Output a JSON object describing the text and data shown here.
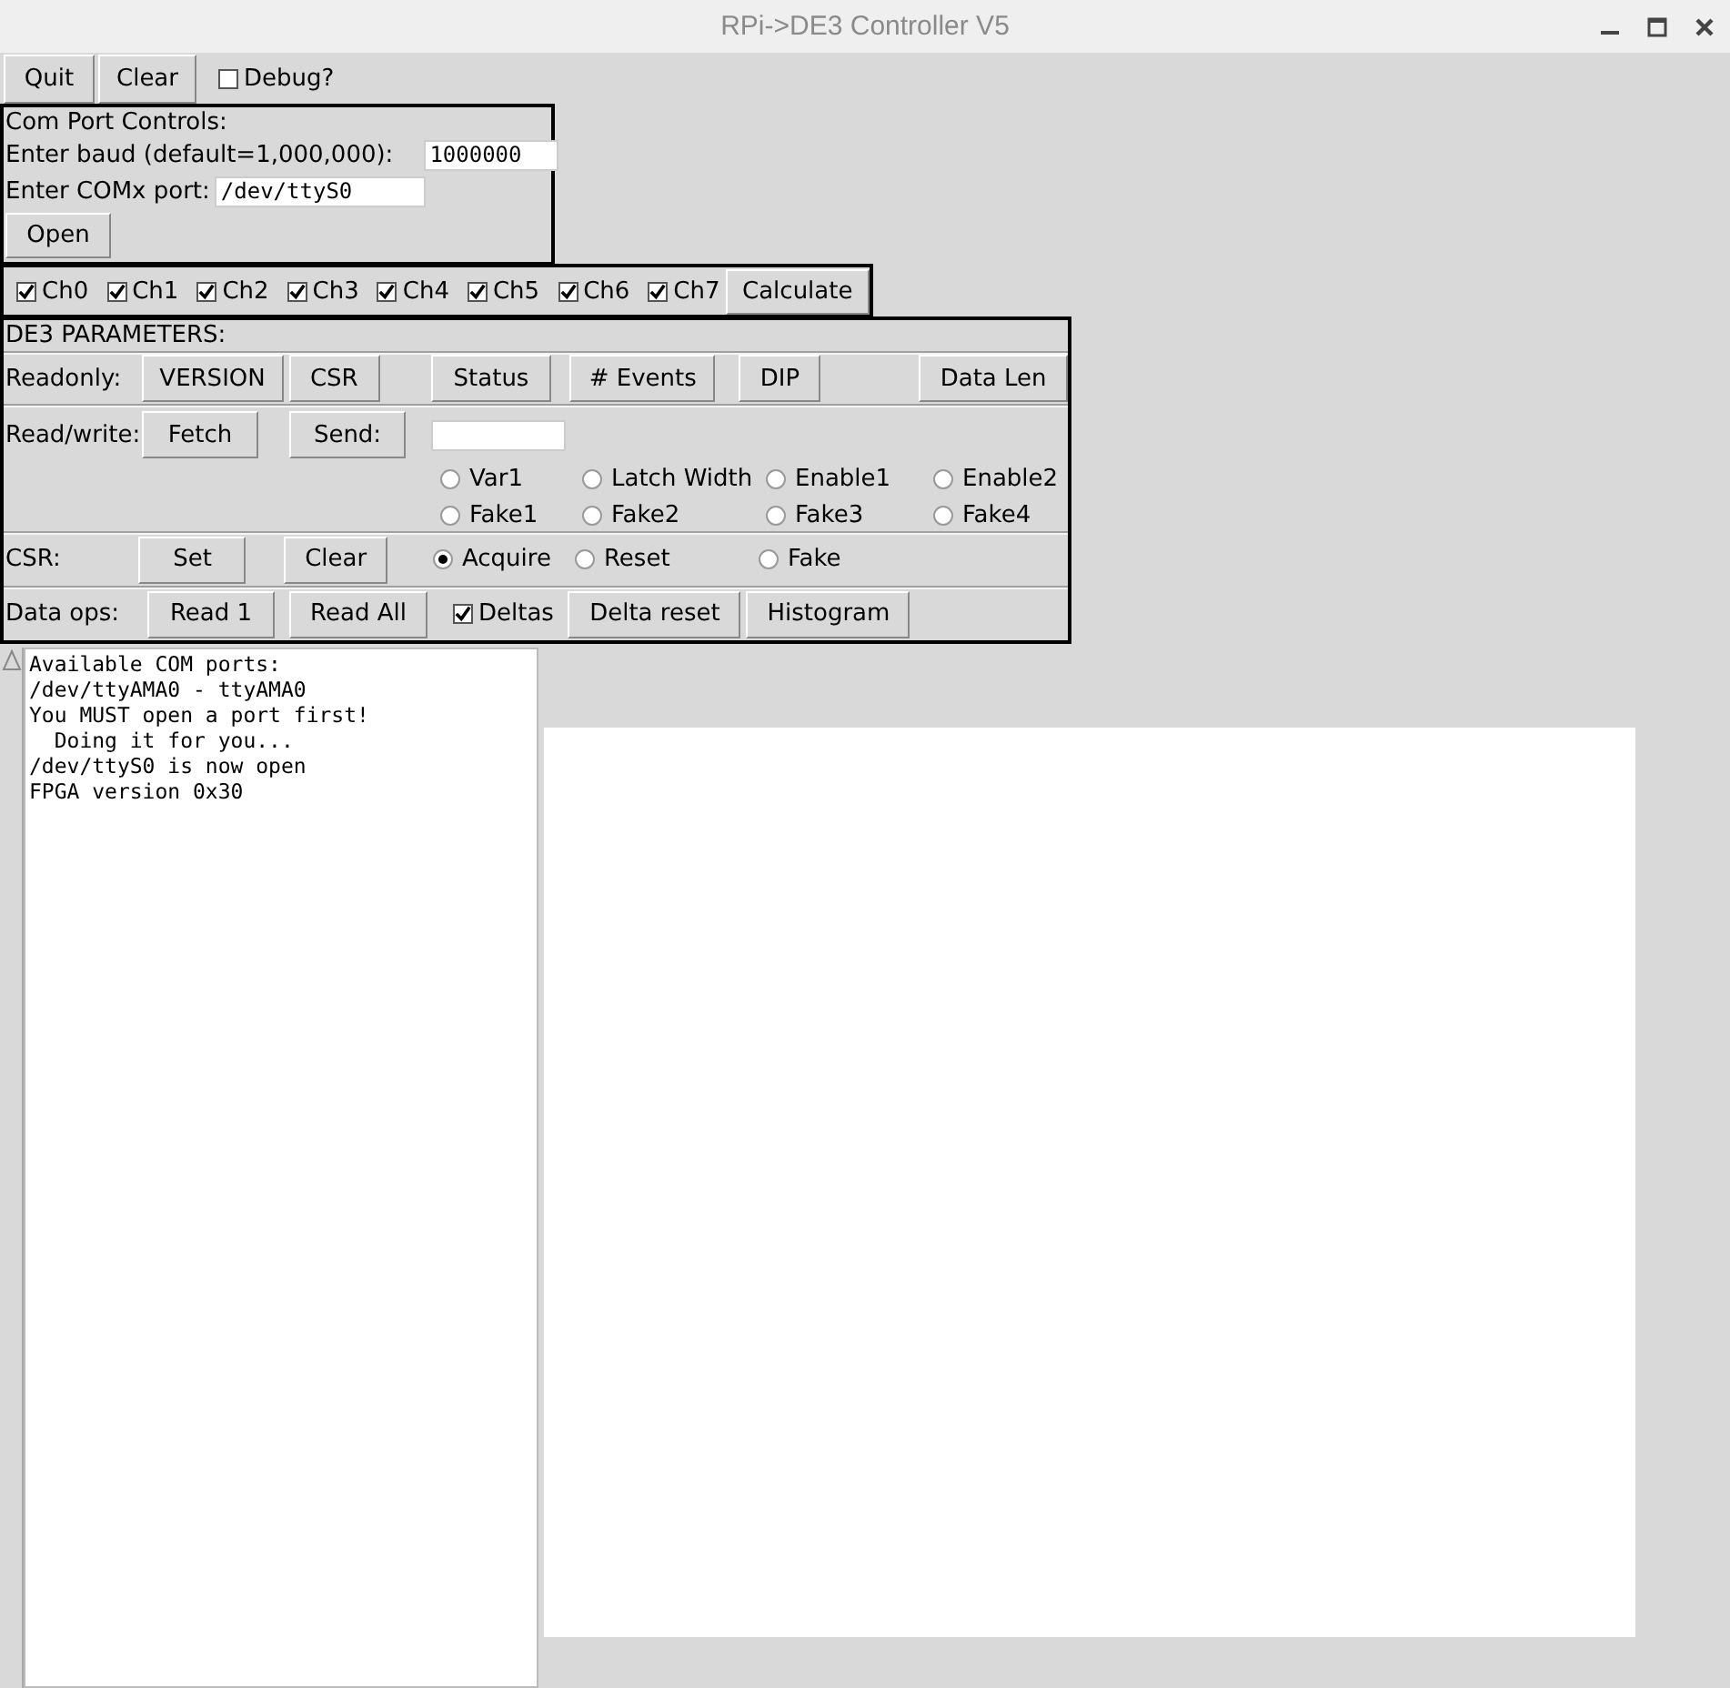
{
  "window": {
    "title": "RPi->DE3 Controller V5"
  },
  "toolbar": {
    "buttons": [
      "Quit",
      "Clear"
    ],
    "debug": {
      "label": "Debug?",
      "checked": false
    }
  },
  "com_port": {
    "title": "Com Port Controls:",
    "baud_label": "Enter baud (default=1,000,000):",
    "baud_value": "1000000",
    "port_label": "Enter COMx port:",
    "port_value": "/dev/ttyS0",
    "open_button": "Open"
  },
  "channels": {
    "items": [
      {
        "label": "Ch0",
        "checked": true
      },
      {
        "label": "Ch1",
        "checked": true
      },
      {
        "label": "Ch2",
        "checked": true
      },
      {
        "label": "Ch3",
        "checked": true
      },
      {
        "label": "Ch4",
        "checked": true
      },
      {
        "label": "Ch5",
        "checked": true
      },
      {
        "label": "Ch6",
        "checked": true
      },
      {
        "label": "Ch7",
        "checked": true
      }
    ],
    "button": "Calculate"
  },
  "de3": {
    "title": "DE3 PARAMETERS:",
    "readonly": {
      "label": "Readonly:",
      "buttons": [
        "VERSION",
        "CSR",
        "Status",
        "# Events",
        "DIP",
        "Data Len"
      ]
    },
    "readwrite": {
      "label": "Read/write:",
      "buttons": [
        "Fetch",
        "Send:"
      ],
      "options": [
        {
          "label": "Var1",
          "selected": false
        },
        {
          "label": "Latch Width",
          "selected": false
        },
        {
          "label": "Enable1",
          "selected": false
        },
        {
          "label": "Enable2",
          "selected": false
        },
        {
          "label": "Fake1",
          "selected": false
        },
        {
          "label": "Fake2",
          "selected": false
        },
        {
          "label": "Fake3",
          "selected": false
        },
        {
          "label": "Fake4",
          "selected": false
        }
      ]
    },
    "csr": {
      "label": "CSR:",
      "buttons": [
        "Set",
        "Clear"
      ],
      "options": [
        {
          "label": "Acquire",
          "selected": true
        },
        {
          "label": "Reset",
          "selected": false
        },
        {
          "label": "Fake",
          "selected": false
        }
      ]
    },
    "data_ops": {
      "label": "Data ops:",
      "items": [
        {
          "kind": "button",
          "label": "Read 1"
        },
        {
          "kind": "button",
          "label": "Read All"
        },
        {
          "kind": "checkbox",
          "label": "Deltas",
          "checked": true
        },
        {
          "kind": "button",
          "label": "Delta reset"
        },
        {
          "kind": "button",
          "label": "Histogram"
        }
      ]
    }
  },
  "log": {
    "lines": [
      "Available COM ports:",
      "/dev/ttyAMA0 - ttyAMA0",
      "You MUST open a port first!",
      "  Doing it for you...",
      "/dev/ttyS0 is now open",
      "FPGA version 0x30"
    ]
  }
}
